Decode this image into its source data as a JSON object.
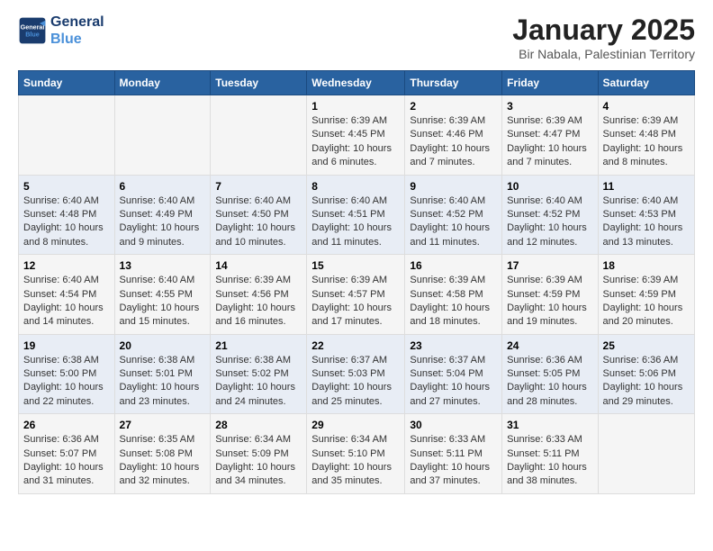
{
  "header": {
    "logo_line1": "General",
    "logo_line2": "Blue",
    "title": "January 2025",
    "subtitle": "Bir Nabala, Palestinian Territory"
  },
  "weekdays": [
    "Sunday",
    "Monday",
    "Tuesday",
    "Wednesday",
    "Thursday",
    "Friday",
    "Saturday"
  ],
  "weeks": [
    [
      {
        "day": "",
        "info": ""
      },
      {
        "day": "",
        "info": ""
      },
      {
        "day": "",
        "info": ""
      },
      {
        "day": "1",
        "info": "Sunrise: 6:39 AM\nSunset: 4:45 PM\nDaylight: 10 hours\nand 6 minutes."
      },
      {
        "day": "2",
        "info": "Sunrise: 6:39 AM\nSunset: 4:46 PM\nDaylight: 10 hours\nand 7 minutes."
      },
      {
        "day": "3",
        "info": "Sunrise: 6:39 AM\nSunset: 4:47 PM\nDaylight: 10 hours\nand 7 minutes."
      },
      {
        "day": "4",
        "info": "Sunrise: 6:39 AM\nSunset: 4:48 PM\nDaylight: 10 hours\nand 8 minutes."
      }
    ],
    [
      {
        "day": "5",
        "info": "Sunrise: 6:40 AM\nSunset: 4:48 PM\nDaylight: 10 hours\nand 8 minutes."
      },
      {
        "day": "6",
        "info": "Sunrise: 6:40 AM\nSunset: 4:49 PM\nDaylight: 10 hours\nand 9 minutes."
      },
      {
        "day": "7",
        "info": "Sunrise: 6:40 AM\nSunset: 4:50 PM\nDaylight: 10 hours\nand 10 minutes."
      },
      {
        "day": "8",
        "info": "Sunrise: 6:40 AM\nSunset: 4:51 PM\nDaylight: 10 hours\nand 11 minutes."
      },
      {
        "day": "9",
        "info": "Sunrise: 6:40 AM\nSunset: 4:52 PM\nDaylight: 10 hours\nand 11 minutes."
      },
      {
        "day": "10",
        "info": "Sunrise: 6:40 AM\nSunset: 4:52 PM\nDaylight: 10 hours\nand 12 minutes."
      },
      {
        "day": "11",
        "info": "Sunrise: 6:40 AM\nSunset: 4:53 PM\nDaylight: 10 hours\nand 13 minutes."
      }
    ],
    [
      {
        "day": "12",
        "info": "Sunrise: 6:40 AM\nSunset: 4:54 PM\nDaylight: 10 hours\nand 14 minutes."
      },
      {
        "day": "13",
        "info": "Sunrise: 6:40 AM\nSunset: 4:55 PM\nDaylight: 10 hours\nand 15 minutes."
      },
      {
        "day": "14",
        "info": "Sunrise: 6:39 AM\nSunset: 4:56 PM\nDaylight: 10 hours\nand 16 minutes."
      },
      {
        "day": "15",
        "info": "Sunrise: 6:39 AM\nSunset: 4:57 PM\nDaylight: 10 hours\nand 17 minutes."
      },
      {
        "day": "16",
        "info": "Sunrise: 6:39 AM\nSunset: 4:58 PM\nDaylight: 10 hours\nand 18 minutes."
      },
      {
        "day": "17",
        "info": "Sunrise: 6:39 AM\nSunset: 4:59 PM\nDaylight: 10 hours\nand 19 minutes."
      },
      {
        "day": "18",
        "info": "Sunrise: 6:39 AM\nSunset: 4:59 PM\nDaylight: 10 hours\nand 20 minutes."
      }
    ],
    [
      {
        "day": "19",
        "info": "Sunrise: 6:38 AM\nSunset: 5:00 PM\nDaylight: 10 hours\nand 22 minutes."
      },
      {
        "day": "20",
        "info": "Sunrise: 6:38 AM\nSunset: 5:01 PM\nDaylight: 10 hours\nand 23 minutes."
      },
      {
        "day": "21",
        "info": "Sunrise: 6:38 AM\nSunset: 5:02 PM\nDaylight: 10 hours\nand 24 minutes."
      },
      {
        "day": "22",
        "info": "Sunrise: 6:37 AM\nSunset: 5:03 PM\nDaylight: 10 hours\nand 25 minutes."
      },
      {
        "day": "23",
        "info": "Sunrise: 6:37 AM\nSunset: 5:04 PM\nDaylight: 10 hours\nand 27 minutes."
      },
      {
        "day": "24",
        "info": "Sunrise: 6:36 AM\nSunset: 5:05 PM\nDaylight: 10 hours\nand 28 minutes."
      },
      {
        "day": "25",
        "info": "Sunrise: 6:36 AM\nSunset: 5:06 PM\nDaylight: 10 hours\nand 29 minutes."
      }
    ],
    [
      {
        "day": "26",
        "info": "Sunrise: 6:36 AM\nSunset: 5:07 PM\nDaylight: 10 hours\nand 31 minutes."
      },
      {
        "day": "27",
        "info": "Sunrise: 6:35 AM\nSunset: 5:08 PM\nDaylight: 10 hours\nand 32 minutes."
      },
      {
        "day": "28",
        "info": "Sunrise: 6:34 AM\nSunset: 5:09 PM\nDaylight: 10 hours\nand 34 minutes."
      },
      {
        "day": "29",
        "info": "Sunrise: 6:34 AM\nSunset: 5:10 PM\nDaylight: 10 hours\nand 35 minutes."
      },
      {
        "day": "30",
        "info": "Sunrise: 6:33 AM\nSunset: 5:11 PM\nDaylight: 10 hours\nand 37 minutes."
      },
      {
        "day": "31",
        "info": "Sunrise: 6:33 AM\nSunset: 5:11 PM\nDaylight: 10 hours\nand 38 minutes."
      },
      {
        "day": "",
        "info": ""
      }
    ]
  ]
}
